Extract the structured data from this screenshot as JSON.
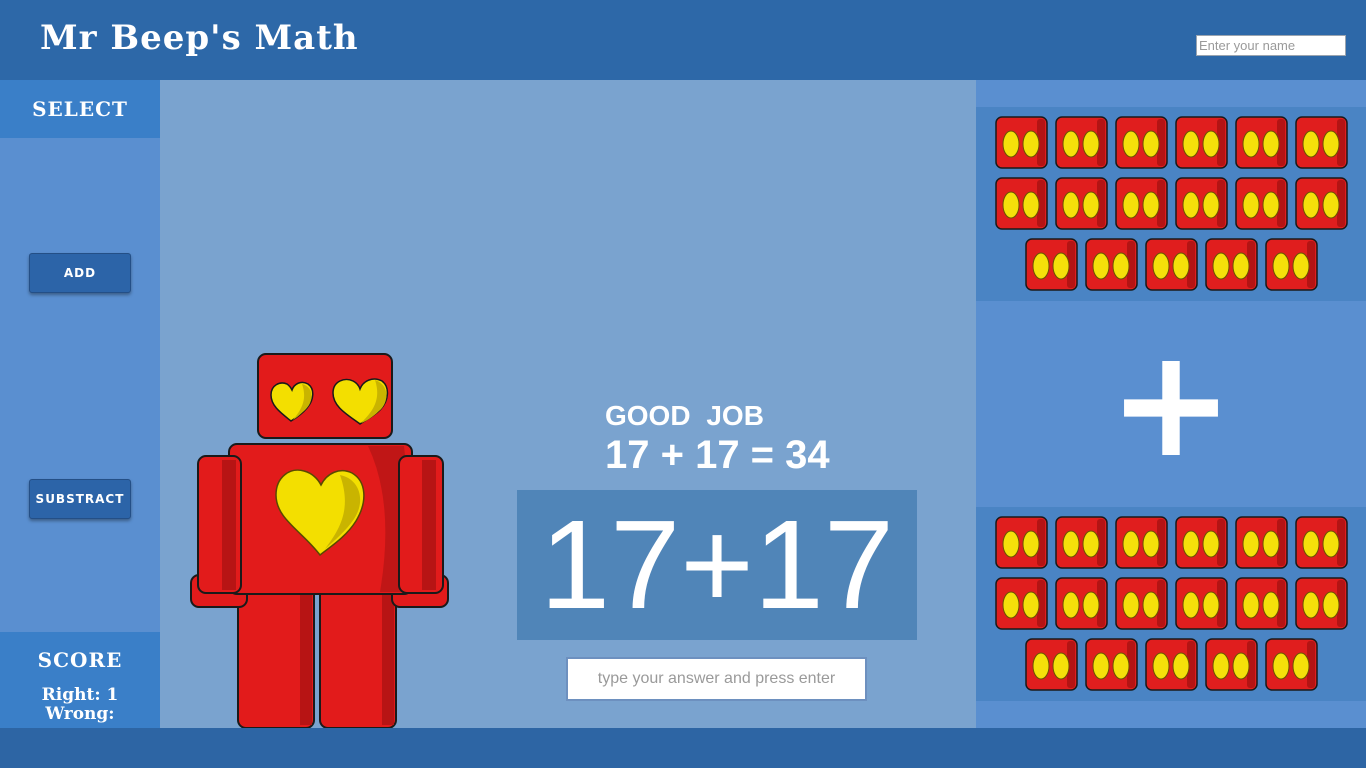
{
  "header": {
    "logo": "Mr Beep's Math",
    "name_placeholder": "Enter your name"
  },
  "sidebar": {
    "select_label": "SELECT",
    "add_label": "ADD",
    "subtract_label": "SUBSTRACT",
    "score_label": "SCORE",
    "right_label": "Right: 1",
    "wrong_label": "Wrong:"
  },
  "main": {
    "feedback_title": "GOOD JOB",
    "feedback_equation": "17 + 17 = 34",
    "problem": "17+17",
    "answer_placeholder": "type your answer and press enter"
  },
  "visual": {
    "operator": "+",
    "top_block_count": 17,
    "bottom_block_count": 17
  },
  "colors": {
    "block_red": "#e01e1e",
    "block_dark": "#b31414",
    "eye_yellow": "#f5e00a",
    "robot_red": "#e21b1b",
    "heart_yellow": "#f3df00"
  }
}
